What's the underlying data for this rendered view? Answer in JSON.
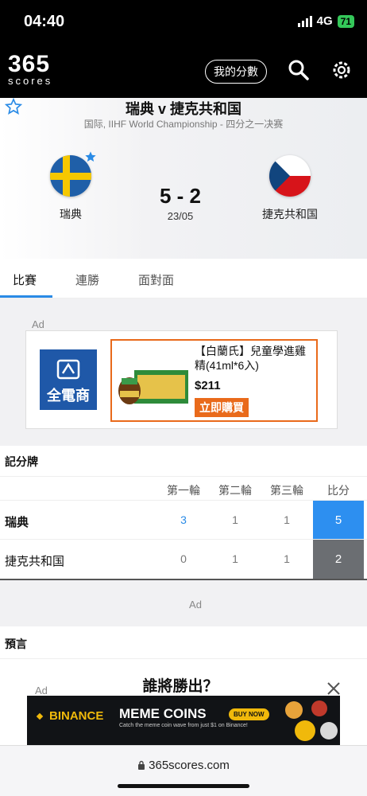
{
  "status_bar": {
    "time": "04:40",
    "network": "4G",
    "battery": "71"
  },
  "header": {
    "logo_main": "365",
    "logo_sub": "scores",
    "my_scores": "我的分數"
  },
  "match": {
    "title": "瑞典 v 捷克共和国",
    "subtitle": "国际, IIHF World Championship - 四分之一决赛",
    "home_team": "瑞典",
    "away_team": "捷克共和国",
    "score": "5 - 2",
    "date": "23/05"
  },
  "tabs": [
    "比賽",
    "連勝",
    "面對面"
  ],
  "ad1": {
    "label": "Ad",
    "logo_text": "全電商",
    "product_title": "【白蘭氏】兒童學進雞精(41ml*6入)",
    "price": "$211",
    "buy_label": "立即購買"
  },
  "scoreboard": {
    "title": "記分牌",
    "headers": [
      "第一輪",
      "第二輪",
      "第三輪",
      "比分"
    ],
    "rows": [
      {
        "team": "瑞典",
        "p1": "3",
        "p2": "1",
        "p3": "1",
        "total": "5"
      },
      {
        "team": "捷克共和国",
        "p1": "0",
        "p2": "1",
        "p3": "1",
        "total": "2"
      }
    ]
  },
  "ad2_label": "Ad",
  "prediction": {
    "title": "預言",
    "ad_label": "Ad",
    "question": "誰將勝出？"
  },
  "banner": {
    "brand": "BINANCE",
    "headline": "MEME COINS",
    "button": "BUY NOW",
    "sub": "Catch the meme coin wave from just $1 on Binance!"
  },
  "browser": {
    "url": "365scores.com"
  },
  "colors": {
    "accent_blue": "#2a8be6",
    "win_cell": "#2d8ff0",
    "lose_cell": "#6b6e72",
    "ad_orange": "#e96a1b"
  }
}
